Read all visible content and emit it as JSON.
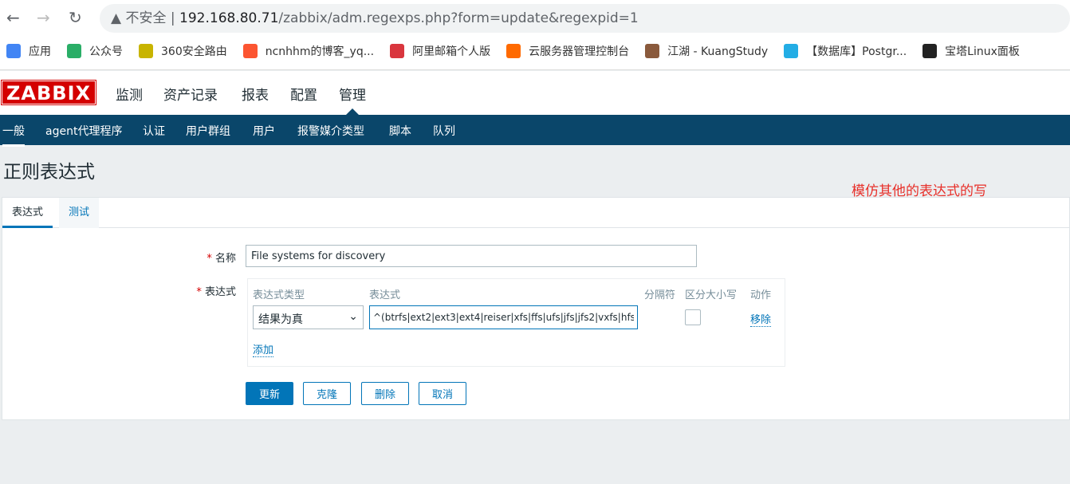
{
  "browser": {
    "insecure_label": "不安全",
    "url_host": "192.168.80.71",
    "url_path": "/zabbix/adm.regexps.php?form=update&regexpid=1",
    "bookmarks": [
      {
        "label": "应用",
        "icon": "apps-grid-icon",
        "color": "#4285f4"
      },
      {
        "label": "公众号",
        "icon": "wechat-icon",
        "color": "#2aae67"
      },
      {
        "label": "360安全路由",
        "icon": "360-icon",
        "color": "#c8b400"
      },
      {
        "label": "ncnhhm的博客_yq...",
        "icon": "csdn-icon",
        "color": "#fc5531"
      },
      {
        "label": "阿里邮箱个人版",
        "icon": "mail-icon",
        "color": "#d9363e"
      },
      {
        "label": "云服务器管理控制台",
        "icon": "aliyun-icon",
        "color": "#ff6a00"
      },
      {
        "label": "江湖 - KuangStudy",
        "icon": "avatar-icon",
        "color": "#8a5a3c"
      },
      {
        "label": "【数据库】Postgr...",
        "icon": "bilibili-icon",
        "color": "#23ade5"
      },
      {
        "label": "宝塔Linux面板",
        "icon": "bt-icon",
        "color": "#222222"
      }
    ]
  },
  "app": {
    "logo": "ZABBIX",
    "menu": [
      "监测",
      "资产记录",
      "报表",
      "配置",
      "管理"
    ],
    "submenu": [
      "一般",
      "agent代理程序",
      "认证",
      "用户群组",
      "用户",
      "报警媒介类型",
      "脚本",
      "队列"
    ]
  },
  "page": {
    "title": "正则表达式",
    "annotation": "模仿其他的表达式的写",
    "tabs": [
      "表达式",
      "测试"
    ],
    "form": {
      "name_label": "名称",
      "name_value": "File systems for discovery",
      "expr_label": "表达式",
      "headers": {
        "type": "表达式类型",
        "expr": "表达式",
        "delim": "分隔符",
        "case": "区分大小写",
        "action": "动作"
      },
      "row": {
        "type": "结果为真",
        "expr": "^(btrfs|ext2|ext3|ext4|reiser|xfs|ffs|ufs|jfs|jfs2|vxfs|hfs",
        "case_sensitive": false,
        "remove": "移除"
      },
      "add": "添加"
    },
    "buttons": {
      "update": "更新",
      "clone": "克隆",
      "delete": "删除",
      "cancel": "取消"
    }
  },
  "colors": {
    "accent": "#0275b8",
    "nav": "#0a466a",
    "logo": "#d40000",
    "annotation": "#e8302a"
  }
}
